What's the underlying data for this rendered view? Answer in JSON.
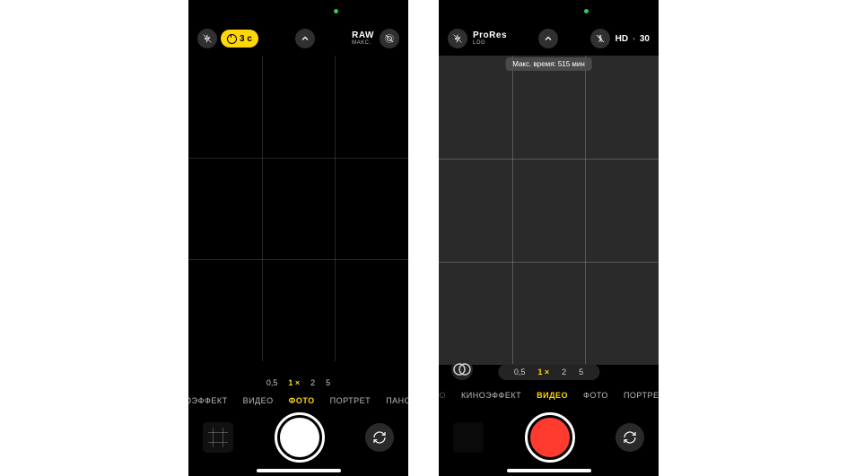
{
  "phone1": {
    "timer_label": "3 с",
    "raw": {
      "title": "RAW",
      "subtitle": "MAKC."
    },
    "zoom": {
      "levels": [
        "0,5",
        "1 ×",
        "2",
        "5"
      ],
      "active_index": 1
    },
    "modes": {
      "items": [
        "КИНОЭФФЕКТ",
        "ВИДЕО",
        "ФОТО",
        "ПОРТРЕТ",
        "ПАНОРАМ"
      ],
      "active_index": 2
    }
  },
  "phone2": {
    "prores": {
      "title": "ProRes",
      "subtitle": "LOG"
    },
    "hd": "HD",
    "fps": "30",
    "max_time": "Макс. время: 515 мин",
    "zoom": {
      "levels": [
        "0,5",
        "1 ×",
        "2",
        "5"
      ],
      "active_index": 1
    },
    "modes": {
      "items": [
        "НО",
        "КИНОЭФФЕКТ",
        "ВИДЕО",
        "ФОТО",
        "ПОРТРЕТ"
      ],
      "active_index": 2,
      "dim_first": true
    }
  }
}
